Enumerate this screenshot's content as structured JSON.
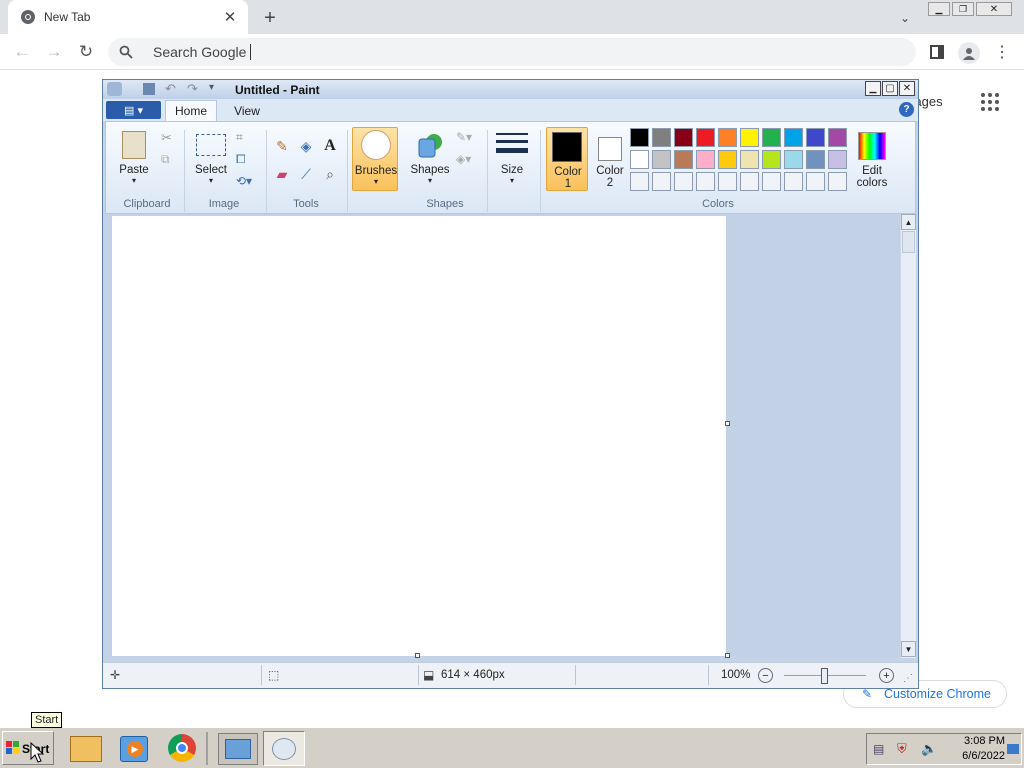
{
  "chrome": {
    "tab_title": "New Tab",
    "search_placeholder": "Search Google",
    "images_link": "Images",
    "customize_button": "Customize Chrome",
    "icons": {
      "tab_favicon": "chrome-icon",
      "close_tab": "close-icon",
      "new_tab": "plus-icon",
      "back": "back-arrow-icon",
      "forward": "forward-arrow-icon",
      "reload": "reload-icon",
      "search": "search-icon",
      "side_panel": "side-panel-icon",
      "profile": "profile-icon",
      "menu": "kebab-menu-icon",
      "apps": "apps-grid-icon",
      "tab_search": "chevron-down-icon"
    }
  },
  "paint": {
    "title": "Untitled - Paint",
    "tabs": [
      "Home",
      "View"
    ],
    "groups": {
      "clipboard": {
        "label": "Clipboard",
        "paste": "Paste"
      },
      "image": {
        "label": "Image",
        "select": "Select"
      },
      "tools": {
        "label": "Tools"
      },
      "shapes": {
        "label": "Shapes",
        "brushes": "Brushes",
        "shapes": "Shapes"
      },
      "size": "Size",
      "colors": {
        "label": "Colors",
        "color1_a": "Color",
        "color1_b": "1",
        "color2_a": "Color",
        "color2_b": "2",
        "edit_a": "Edit",
        "edit_b": "colors"
      }
    },
    "palette": [
      "#000000",
      "#7f7f7f",
      "#880015",
      "#ed1c24",
      "#ff7f27",
      "#fff200",
      "#22b14c",
      "#00a2e8",
      "#3f48cc",
      "#a349a4",
      "#ffffff",
      "#c3c3c3",
      "#b97a57",
      "#ffaec9",
      "#ffc90e",
      "#efe4b0",
      "#b5e61d",
      "#99d9ea",
      "#7092be",
      "#c8bfe7"
    ],
    "color1": "#000000",
    "color2": "#ffffff",
    "status": {
      "dimensions": "614 × 460px",
      "zoom": "100%"
    }
  },
  "taskbar": {
    "start": "Start",
    "tooltip": "Start",
    "time": "3:08 PM",
    "date": "6/6/2022"
  }
}
